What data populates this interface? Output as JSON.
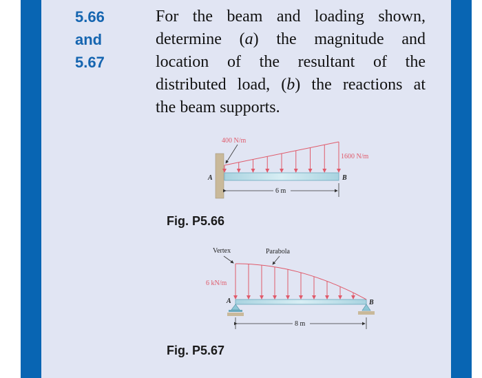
{
  "problem": {
    "number_lines": [
      "5.66",
      "and",
      "5.67"
    ],
    "text_lines": [
      [
        "For the beam and loading shown,"
      ],
      [
        "determine (",
        "a",
        ") the magnitude and"
      ],
      [
        "location of the resultant of the"
      ],
      [
        "distributed load, (",
        "b",
        ") the reactions at"
      ],
      [
        "the beam supports."
      ]
    ]
  },
  "figures": [
    {
      "caption": "Fig. P5.66",
      "load_left_label": "400 N/m",
      "load_right_label": "1600 N/m",
      "support_left_label": "A",
      "support_right_label": "B",
      "span_label": "6 m",
      "load_type": "linear (trapezoidal)",
      "load_left_value": "400 N/m",
      "load_right_value": "1600 N/m",
      "span": "6 m"
    },
    {
      "caption": "Fig. P5.67",
      "vertex_label": "Vertex",
      "parabola_label": "Parabola",
      "load_label": "6 kN/m",
      "support_left_label": "A",
      "support_right_label": "B",
      "span_label": "8 m",
      "load_type": "parabolic",
      "load_max_value": "6 kN/m",
      "span": "8 m"
    }
  ],
  "colors": {
    "accent_bar": "#0865b3",
    "panel_bg": "#e1e5f3",
    "number_text": "#1565b0",
    "load_red": "#e05a6a",
    "beam_blue": "#bfe0ea"
  }
}
